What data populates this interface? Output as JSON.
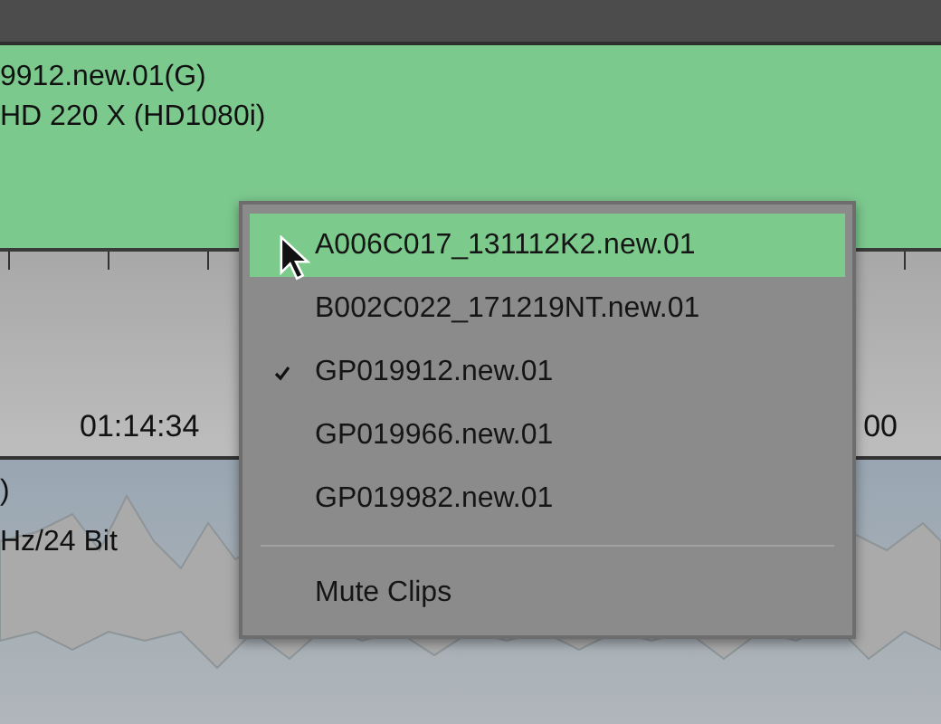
{
  "clip": {
    "name": "9912.new.01(G)",
    "format": "HD 220 X (HD1080i)"
  },
  "ruler": {
    "timecodes": [
      "01:14:34",
      "00"
    ]
  },
  "audio_track": {
    "lines": [
      ")",
      "Hz/24 Bit"
    ]
  },
  "menu": {
    "items": [
      {
        "kind": "clip",
        "label": "A006C017_131112K2.new.01",
        "checked": false,
        "selected": true
      },
      {
        "kind": "clip",
        "label": "B002C022_171219NT.new.01",
        "checked": false,
        "selected": false
      },
      {
        "kind": "clip",
        "label": "GP019912.new.01",
        "checked": true,
        "selected": false
      },
      {
        "kind": "clip",
        "label": "GP019966.new.01",
        "checked": false,
        "selected": false
      },
      {
        "kind": "clip",
        "label": "GP019982.new.01",
        "checked": false,
        "selected": false
      },
      {
        "kind": "separator"
      },
      {
        "kind": "action",
        "label": "Mute Clips",
        "checked": false,
        "selected": false
      }
    ]
  }
}
